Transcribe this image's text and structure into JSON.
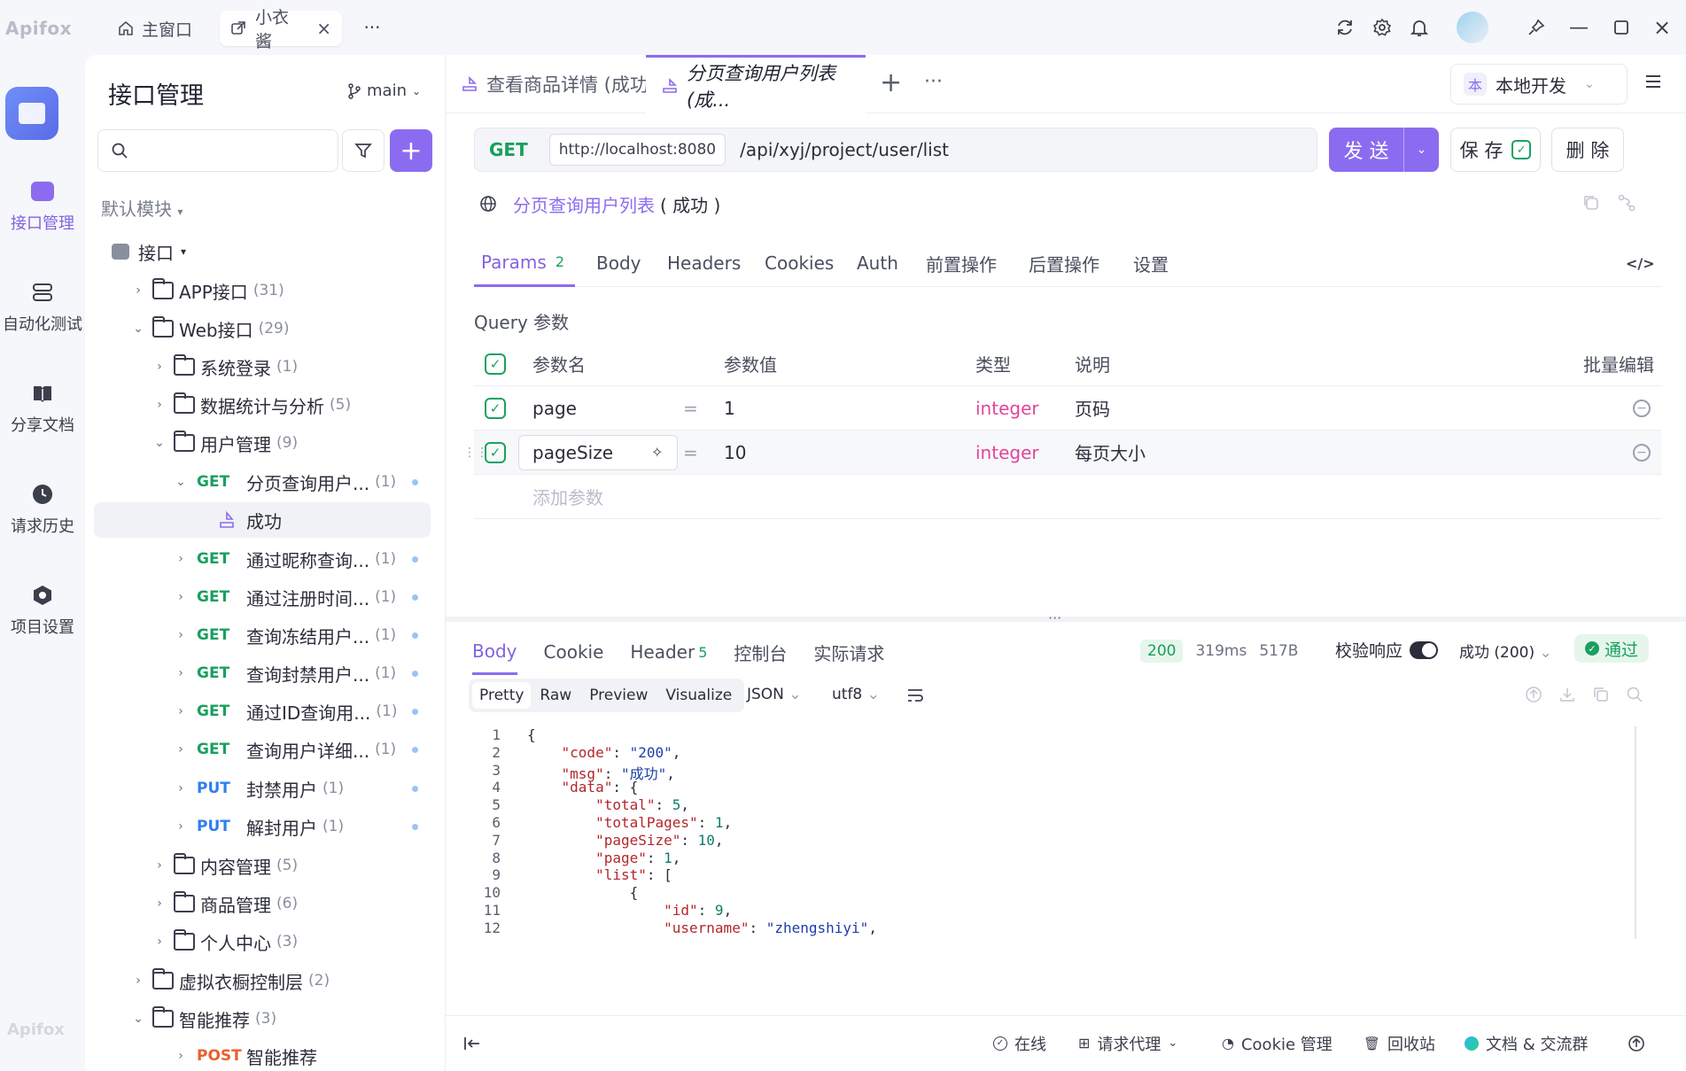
{
  "titlebar": {
    "logo": "Apifox",
    "tabs": [
      {
        "label": "主窗口"
      },
      {
        "label": "小衣酱"
      }
    ],
    "more": "···"
  },
  "rail": {
    "items": [
      {
        "label": "接口管理"
      },
      {
        "label": "自动化测试"
      },
      {
        "label": "分享文档"
      },
      {
        "label": "请求历史"
      },
      {
        "label": "项目设置"
      }
    ],
    "bottom_logo": "Apifox"
  },
  "sidebar": {
    "title": "接口管理",
    "branch": "main",
    "module": "默认模块",
    "root": "接口",
    "tree": [
      {
        "type": "folder",
        "label": "APP接口",
        "count": "(31)"
      },
      {
        "type": "folder",
        "label": "Web接口",
        "count": "(29)"
      },
      {
        "type": "folder",
        "label": "系统登录",
        "count": "(1)"
      },
      {
        "type": "folder",
        "label": "数据统计与分析",
        "count": "(5)"
      },
      {
        "type": "folder",
        "label": "用户管理",
        "count": "(9)"
      },
      {
        "type": "api",
        "method": "GET",
        "label": "分页查询用户...",
        "count": "(1)"
      },
      {
        "type": "case",
        "label": "成功"
      },
      {
        "type": "api",
        "method": "GET",
        "label": "通过昵称查询...",
        "count": "(1)"
      },
      {
        "type": "api",
        "method": "GET",
        "label": "通过注册时间...",
        "count": "(1)"
      },
      {
        "type": "api",
        "method": "GET",
        "label": "查询冻结用户...",
        "count": "(1)"
      },
      {
        "type": "api",
        "method": "GET",
        "label": "查询封禁用户...",
        "count": "(1)"
      },
      {
        "type": "api",
        "method": "GET",
        "label": "通过ID查询用...",
        "count": "(1)"
      },
      {
        "type": "api",
        "method": "GET",
        "label": "查询用户详细...",
        "count": "(1)"
      },
      {
        "type": "api",
        "method": "PUT",
        "label": "封禁用户",
        "count": "(1)"
      },
      {
        "type": "api",
        "method": "PUT",
        "label": "解封用户",
        "count": "(1)"
      },
      {
        "type": "folder",
        "label": "内容管理",
        "count": "(5)"
      },
      {
        "type": "folder",
        "label": "商品管理",
        "count": "(6)"
      },
      {
        "type": "folder",
        "label": "个人中心",
        "count": "(3)"
      },
      {
        "type": "folder",
        "label": "虚拟衣橱控制层",
        "count": "(2)"
      },
      {
        "type": "folder",
        "label": "智能推荐",
        "count": "(3)"
      },
      {
        "type": "api",
        "method": "POST",
        "label": "智能推荐"
      }
    ]
  },
  "main": {
    "tabs": [
      {
        "label": "查看商品详情 (成功)"
      },
      {
        "label": "分页查询用户列表 (成..."
      }
    ],
    "env": "本地开发",
    "env_badge": "本",
    "request": {
      "method": "GET",
      "base_url": "http://localhost:8080",
      "path": "/api/xyj/project/user/list"
    },
    "buttons": {
      "send": "发 送",
      "save": "保 存",
      "delete": "删 除"
    },
    "case_link": "分页查询用户列表",
    "case_status": "( 成功 )",
    "param_tabs": [
      {
        "label": "Params",
        "badge": "2"
      },
      {
        "label": "Body"
      },
      {
        "label": "Headers"
      },
      {
        "label": "Cookies"
      },
      {
        "label": "Auth"
      },
      {
        "label": "前置操作"
      },
      {
        "label": "后置操作"
      },
      {
        "label": "设置"
      }
    ],
    "query_title": "Query 参数",
    "columns": {
      "name": "参数名",
      "value": "参数值",
      "type": "类型",
      "desc": "说明",
      "bulk": "批量编辑"
    },
    "params": [
      {
        "name": "page",
        "value": "1",
        "type": "integer",
        "desc": "页码"
      },
      {
        "name": "pageSize",
        "value": "10",
        "type": "integer",
        "desc": "每页大小"
      }
    ],
    "add_param": "添加参数"
  },
  "response": {
    "tabs": [
      {
        "label": "Body"
      },
      {
        "label": "Cookie"
      },
      {
        "label": "Header",
        "badge": "5"
      },
      {
        "label": "控制台"
      },
      {
        "label": "实际请求"
      }
    ],
    "status": "200",
    "time": "319ms",
    "size": "517B",
    "validate": "校验响应",
    "result": "成功 (200)",
    "pass": "通过",
    "views": [
      "Pretty",
      "Raw",
      "Preview",
      "Visualize"
    ],
    "format": "JSON",
    "encoding": "utf8",
    "code_lines": [
      "{",
      "    \"code\": \"200\",",
      "    \"msg\": \"成功\",",
      "    \"data\": {",
      "        \"total\": 5,",
      "        \"totalPages\": 1,",
      "        \"pageSize\": 10,",
      "        \"page\": 1,",
      "        \"list\": [",
      "            {",
      "                \"id\": 9,",
      "                \"username\": \"zhengshiyi\","
    ]
  },
  "footer": {
    "online": "在线",
    "proxy": "请求代理",
    "cookie": "Cookie 管理",
    "recycle": "回收站",
    "docs": "文档 & 交流群"
  },
  "colors": {
    "accent": "#8b6cf0",
    "get": "#18a05e",
    "put": "#2f7ff0",
    "post": "#e8612c",
    "integer": "#e2459a"
  }
}
